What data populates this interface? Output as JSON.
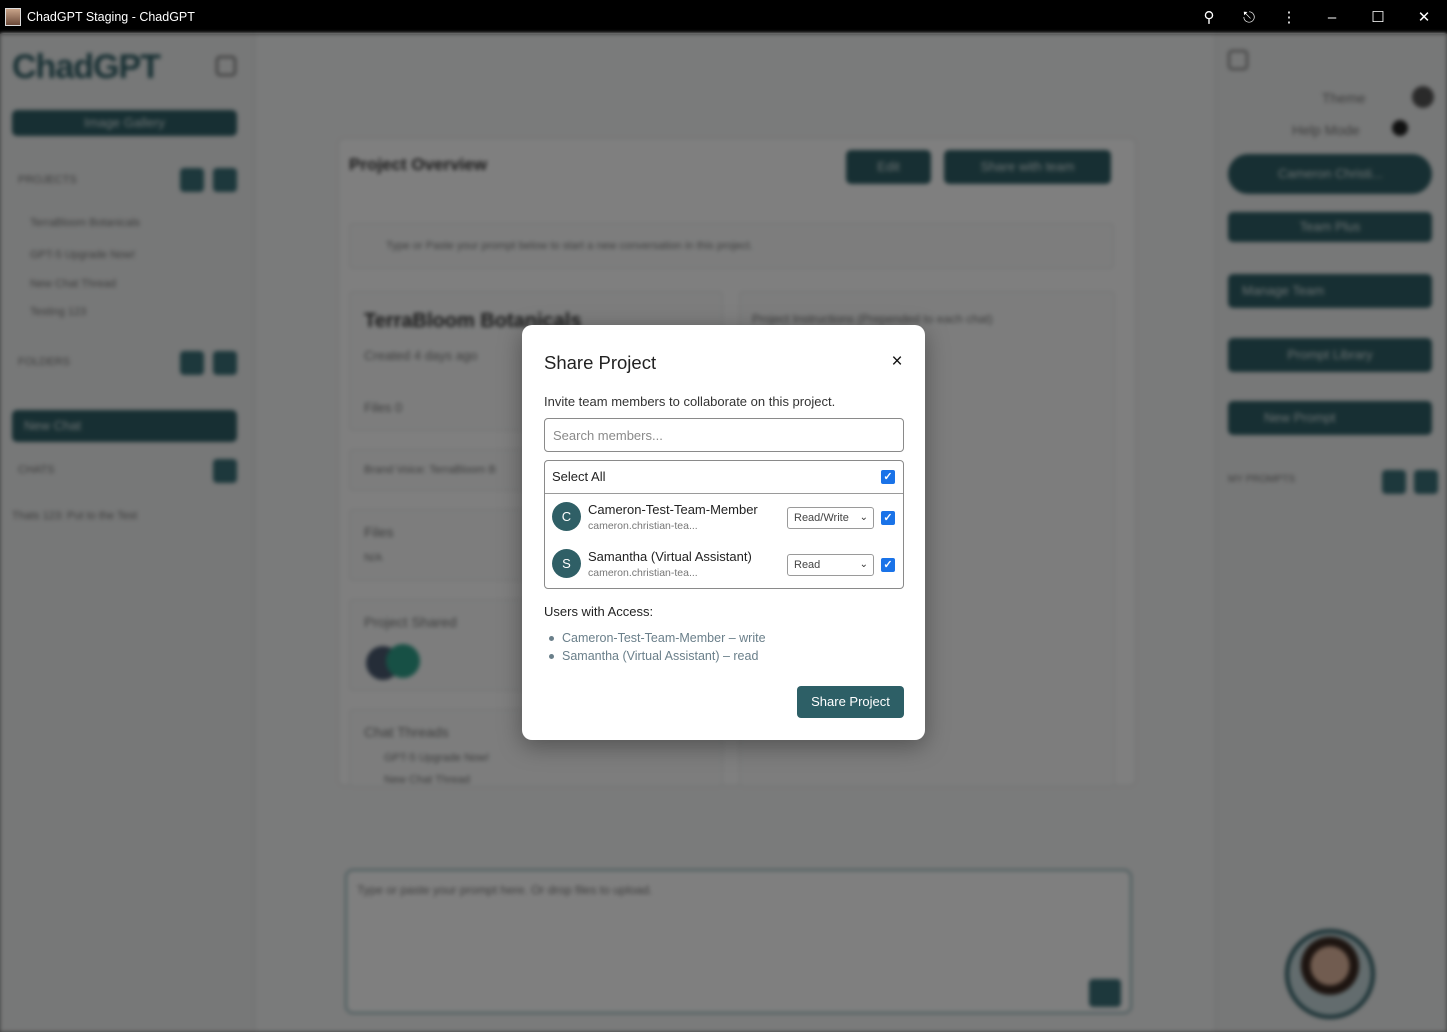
{
  "window": {
    "title": "ChadGPT Staging - ChadGPT"
  },
  "background": {
    "logo": "ChadGPT",
    "image_gallery": "Image Gallery",
    "projects_label": "PROJECTS",
    "project_items": [
      "TerraBloom Botanicals",
      "GPT-5 Upgrade Now!",
      "New Chat Thread",
      "Testing 123"
    ],
    "folders_label": "FOLDERS",
    "new_chat": "New Chat",
    "chats_label": "CHATS",
    "chat_items": [
      "Thats 123: Put to the Test"
    ],
    "main_title": "Project Overview",
    "edit_button": "Edit",
    "share_with_team": "Share with team",
    "hint": "Type or Paste your prompt below to start a new conversation in this project.",
    "project_name": "TerraBloom Botanicals",
    "created": "Created 4 days ago",
    "files_count": "Files 0",
    "brand_voice": "Brand Voice: TerraBloom B",
    "files_label": "Files",
    "files_value": "N/A",
    "project_shared": "Project Shared",
    "chat_threads": "Chat Threads",
    "thread_items": [
      "GPT-5 Upgrade Now!",
      "New Chat Thread"
    ],
    "project_instructions": "Project Instructions (Prepended to each chat)",
    "prompt_placeholder": "Type or paste your prompt here. Or drop files to upload.",
    "theme": "Theme",
    "help_mode": "Help Mode",
    "user_short": "Cameron Christi...",
    "team_plan": "Team Plus",
    "manage_team": "Manage Team",
    "prompt_library": "Prompt Library",
    "new_prompt": "New Prompt",
    "my_prompts": "MY PROMPTS"
  },
  "modal": {
    "title": "Share Project",
    "description": "Invite team members to collaborate on this project.",
    "search_placeholder": "Search members...",
    "select_all_label": "Select All",
    "members": [
      {
        "initial": "C",
        "name": "Cameron-Test-Team-Member",
        "email": "cameron.christian-tea...",
        "permission": "Read/Write",
        "checked": true
      },
      {
        "initial": "S",
        "name": "Samantha (Virtual Assistant)",
        "email": "cameron.christian-tea...",
        "permission": "Read",
        "checked": true
      }
    ],
    "access_title": "Users with Access:",
    "access_list": [
      "Cameron-Test-Team-Member – write",
      "Samantha (Virtual Assistant) – read"
    ],
    "share_button": "Share Project"
  },
  "colors": {
    "accent": "#2d5f66",
    "checkbox": "#1a73e8",
    "access_text": "#6a7f8a"
  }
}
